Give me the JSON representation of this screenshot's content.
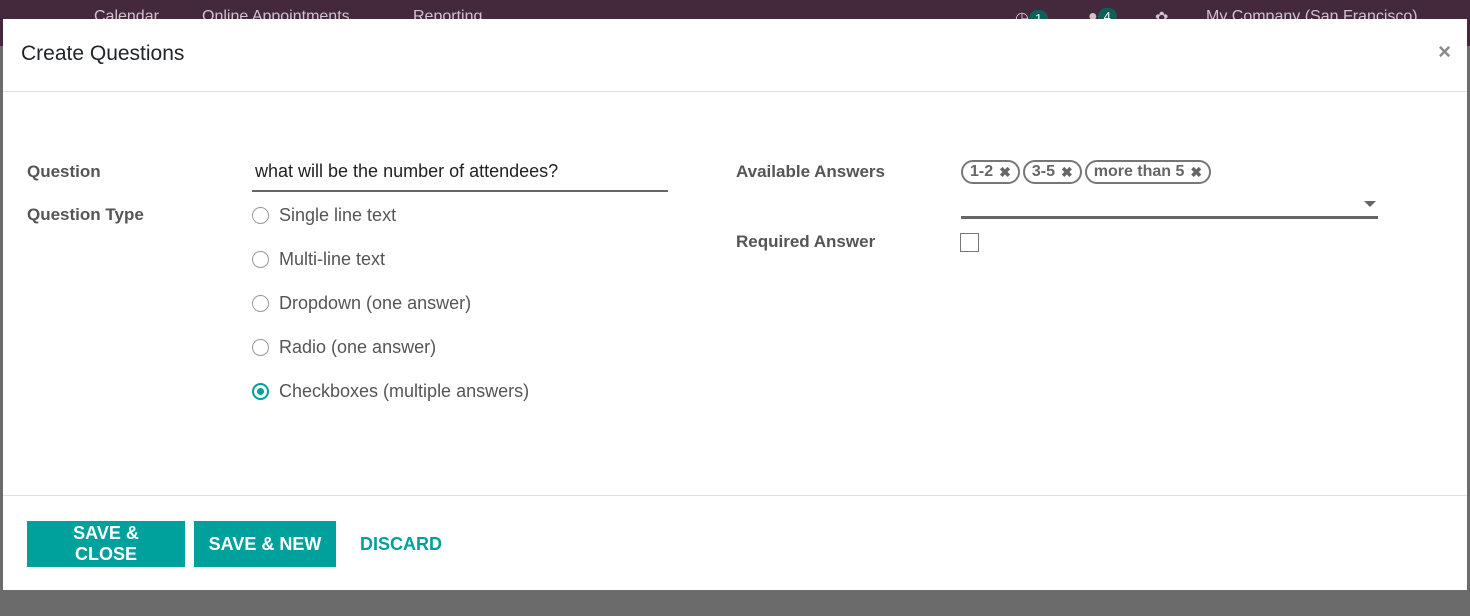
{
  "navbar": {
    "menu": [
      "Calendar",
      "Online Appointments",
      "Reporting"
    ],
    "activity_count": "1",
    "message_count": "4",
    "company": "My Company (San Francisco)"
  },
  "dialog": {
    "title": "Create Questions",
    "question_label": "Question",
    "question_value": "what will be the number of attendees?",
    "question_type_label": "Question Type",
    "question_types": [
      "Single line text",
      "Multi-line text",
      "Dropdown (one answer)",
      "Radio (one answer)",
      "Checkboxes (multiple answers)"
    ],
    "selected_type": "Checkboxes (multiple answers)",
    "available_answers_label": "Available Answers",
    "answers": [
      "1-2",
      "3-5",
      "more than 5"
    ],
    "required_answer_label": "Required Answer",
    "required_answer": false
  },
  "footer": {
    "save_close": "SAVE & CLOSE",
    "save_new": "SAVE & NEW",
    "discard": "DISCARD"
  },
  "colors": {
    "accent": "#00a09d",
    "navbar": "#43293b"
  }
}
